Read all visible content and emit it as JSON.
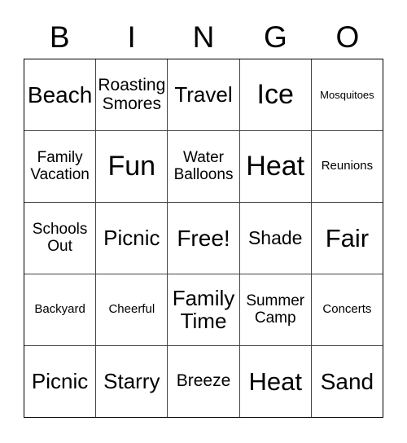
{
  "card": {
    "title_letters": [
      "B",
      "I",
      "N",
      "G",
      "O"
    ],
    "free_space_label": "Free!",
    "colors": {
      "background": "#ffffff",
      "text": "#000000",
      "outer_border": "#000000",
      "grid_line": "#444444"
    },
    "grid": {
      "columns": 5,
      "rows": 5,
      "cells": [
        [
          {
            "text": "Beach",
            "size": "fs-l"
          },
          {
            "text": "Roasting\nSmores",
            "size": "fs-sm"
          },
          {
            "text": "Travel",
            "size": "fs-ml"
          },
          {
            "text": "Ice",
            "size": "fs-xxl"
          },
          {
            "text": "Mosquitoes",
            "size": "fs-xxs"
          }
        ],
        [
          {
            "text": "Family\nVacation",
            "size": "fs-s"
          },
          {
            "text": "Fun",
            "size": "fs-xxl"
          },
          {
            "text": "Water\nBalloons",
            "size": "fs-s"
          },
          {
            "text": "Heat",
            "size": "fs-xxl"
          },
          {
            "text": "Reunions",
            "size": "fs-xs"
          }
        ],
        [
          {
            "text": "Schools\nOut",
            "size": "fs-s"
          },
          {
            "text": "Picnic",
            "size": "fs-ml"
          },
          {
            "text": "Free!",
            "size": "fs-l"
          },
          {
            "text": "Shade",
            "size": "fs-m"
          },
          {
            "text": "Fair",
            "size": "fs-xl"
          }
        ],
        [
          {
            "text": "Backyard",
            "size": "fs-xs"
          },
          {
            "text": "Cheerful",
            "size": "fs-xs"
          },
          {
            "text": "Family\nTime",
            "size": "fs-ml"
          },
          {
            "text": "Summer\nCamp",
            "size": "fs-s"
          },
          {
            "text": "Concerts",
            "size": "fs-xs"
          }
        ],
        [
          {
            "text": "Picnic",
            "size": "fs-ml"
          },
          {
            "text": "Starry",
            "size": "fs-ml"
          },
          {
            "text": "Breeze",
            "size": "fs-sm"
          },
          {
            "text": "Heat",
            "size": "fs-xl"
          },
          {
            "text": "Sand",
            "size": "fs-l"
          }
        ]
      ]
    }
  }
}
